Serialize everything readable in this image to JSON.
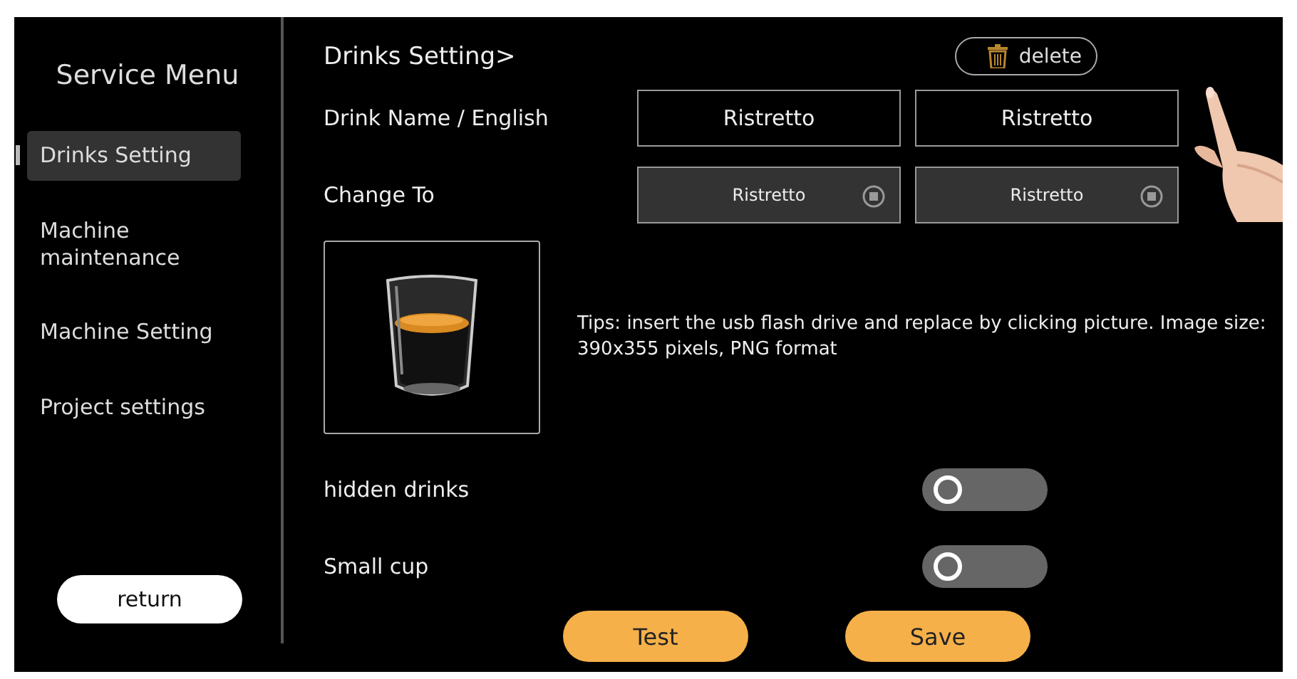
{
  "sidebar": {
    "title": "Service Menu",
    "items": [
      {
        "label": "Drinks Setting",
        "selected": true
      },
      {
        "label": "Machine maintenance",
        "selected": false
      },
      {
        "label": "Machine Setting",
        "selected": false
      },
      {
        "label": "Project settings",
        "selected": false
      }
    ],
    "return_button": "return"
  },
  "header": {
    "title": "Drinks Setting>",
    "delete_button": "delete"
  },
  "name_row": {
    "label": "Drink Name / English",
    "fields": [
      "Ristretto",
      "Ristretto"
    ]
  },
  "change_row": {
    "label": "Change To",
    "fields": [
      "Ristretto",
      "Ristretto"
    ]
  },
  "image": {
    "tip": "Tips: insert the usb flash drive and replace by clicking picture. Image size: 390x355 pixels, PNG format"
  },
  "toggles": [
    {
      "label": "hidden drinks",
      "on": false
    },
    {
      "label": "Small cup",
      "on": false
    }
  ],
  "buttons": [
    "Test",
    "Save"
  ]
}
